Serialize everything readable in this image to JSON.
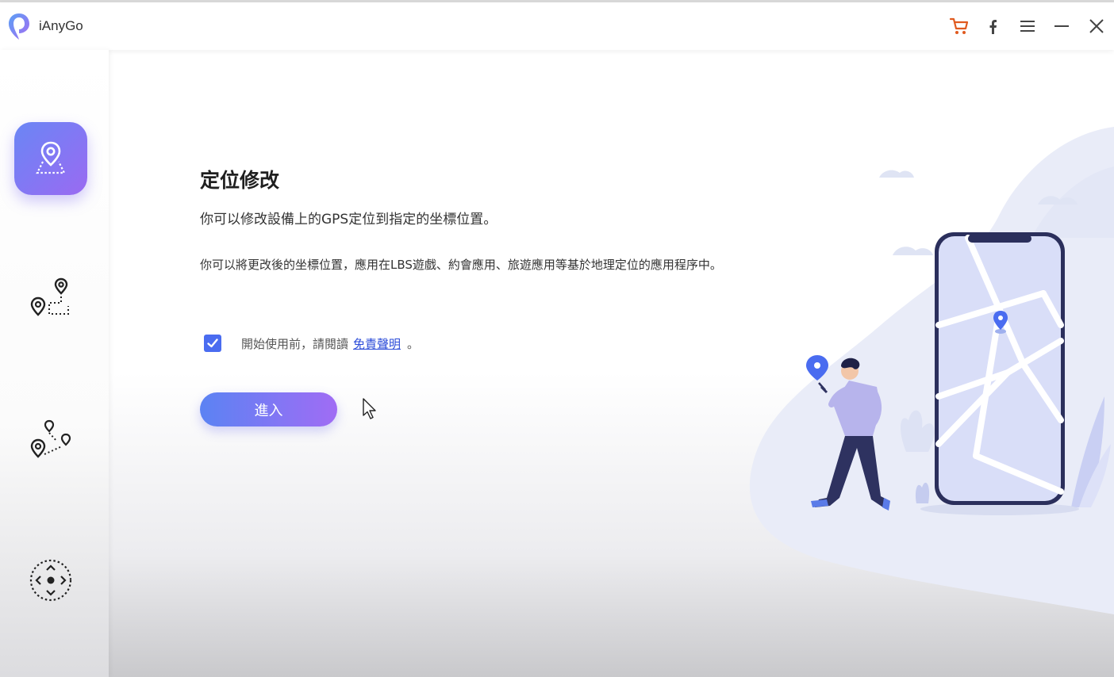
{
  "window": {
    "app_name": "iAnyGo",
    "controls": [
      "cart-icon",
      "facebook-icon",
      "menu-icon",
      "minimize-icon",
      "close-icon"
    ]
  },
  "sidebar": {
    "items": [
      {
        "id": "change-location",
        "icon": "location-pin-area-icon",
        "active": true
      },
      {
        "id": "two-spot-movement",
        "icon": "two-spot-route-icon",
        "active": false
      },
      {
        "id": "multi-spot-movement",
        "icon": "multi-spot-route-icon",
        "active": false
      },
      {
        "id": "joystick-movement",
        "icon": "joystick-icon",
        "active": false
      }
    ]
  },
  "main": {
    "title": "定位修改",
    "subtitle": "你可以修改設備上的GPS定位到指定的坐標位置。",
    "description": "你可以將更改後的坐標位置，應用在LBS遊戲、約會應用、旅遊應用等基於地理定位的應用程序中。",
    "agreement": {
      "checked": true,
      "prefix": "開始使用前，請閱讀",
      "link": "免責聲明",
      "suffix": "。"
    },
    "enter_button": "進入"
  },
  "colors": {
    "accent_start": "#5b83f3",
    "accent_end": "#a06cf4",
    "checkbox": "#4a6cf0",
    "link": "#2a4bd8",
    "cart": "#e05a1f"
  }
}
